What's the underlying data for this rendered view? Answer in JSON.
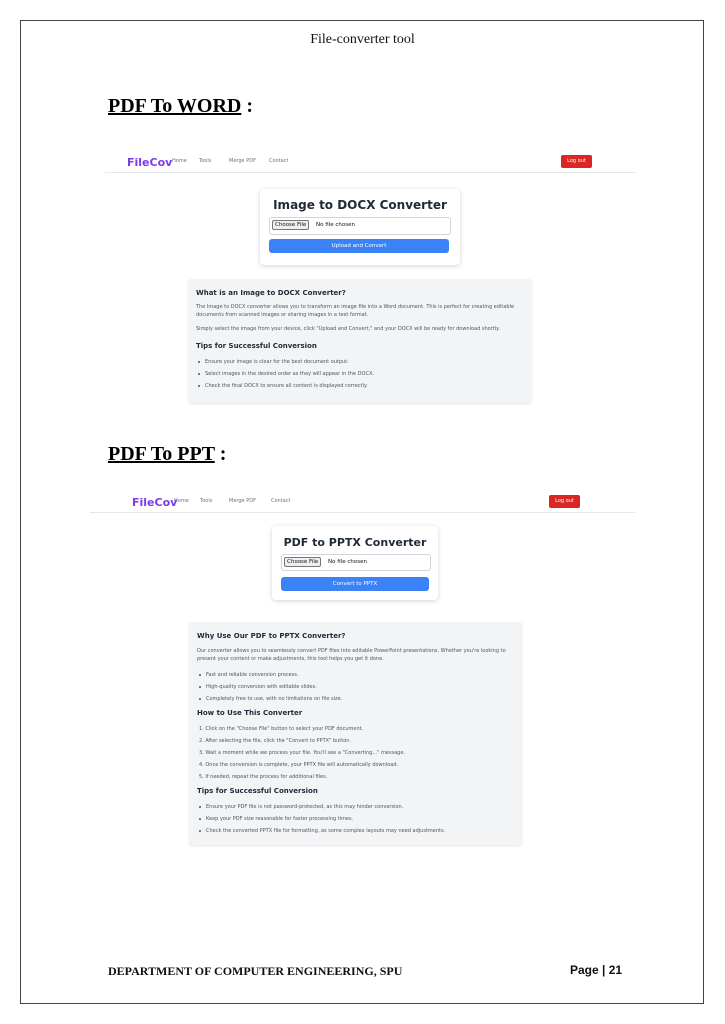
{
  "document": {
    "header_title": "File-converter tool",
    "footer_dept": "DEPARTMENT OF COMPUTER ENGINEERING, SPU",
    "footer_page": "Page | 21"
  },
  "sections": [
    {
      "heading": "PDF To WORD",
      "colon": " :",
      "nav": {
        "brand": "FileCov",
        "links": [
          "Home",
          "Tools",
          "Merge PDF",
          "Contact"
        ],
        "logout": "Log out"
      },
      "card": {
        "title": "Image to DOCX Converter",
        "choose_file": "Choose File",
        "status": "No file chosen",
        "button": "Upload and Convert"
      },
      "info": {
        "heading1": "What is an Image to DOCX Converter?",
        "paragraph1": "The Image to DOCX converter allows you to transform an image file into a Word document. This is perfect for creating editable documents from scanned images or sharing images in a text format.",
        "paragraph2": "Simply select the image from your device, click \"Upload and Convert,\" and your DOCX will be ready for download shortly.",
        "heading2": "Tips for Successful Conversion",
        "tips": [
          "Ensure your image is clear for the best document output.",
          "Select images in the desired order as they will appear in the DOCX.",
          "Check the final DOCX to ensure all content is displayed correctly."
        ]
      }
    },
    {
      "heading": "PDF To PPT",
      "colon": " :",
      "nav": {
        "brand": "FileCov",
        "links": [
          "Home",
          "Tools",
          "Merge PDF",
          "Contact"
        ],
        "logout": "Log out"
      },
      "card": {
        "title": "PDF to PPTX Converter",
        "choose_file": "Choose File",
        "status": "No file chosen",
        "button": "Convert to PPTX"
      },
      "info": {
        "heading1": "Why Use Our PDF to PPTX Converter?",
        "paragraph1": "Our converter allows you to seamlessly convert PDF files into editable PowerPoint presentations. Whether you're looking to present your content or make adjustments, this tool helps you get it done.",
        "bullets": [
          "Fast and reliable conversion process.",
          "High-quality conversion with editable slides.",
          "Completely free to use, with no limitations on file size."
        ],
        "heading2": "How to Use This Converter",
        "steps": [
          "1. Click on the \"Choose File\" button to select your PDF document.",
          "2. After selecting the file, click the \"Convert to PPTX\" button.",
          "3. Wait a moment while we process your file. You'll see a \"Converting...\" message.",
          "4. Once the conversion is complete, your PPTX file will automatically download.",
          "5. If needed, repeat the process for additional files."
        ],
        "heading3": "Tips for Successful Conversion",
        "tips": [
          "Ensure your PDF file is not password-protected, as this may hinder conversion.",
          "Keep your PDF size reasonable for faster processing times.",
          "Check the converted PPTX file for formatting, as some complex layouts may need adjustments."
        ]
      }
    }
  ]
}
